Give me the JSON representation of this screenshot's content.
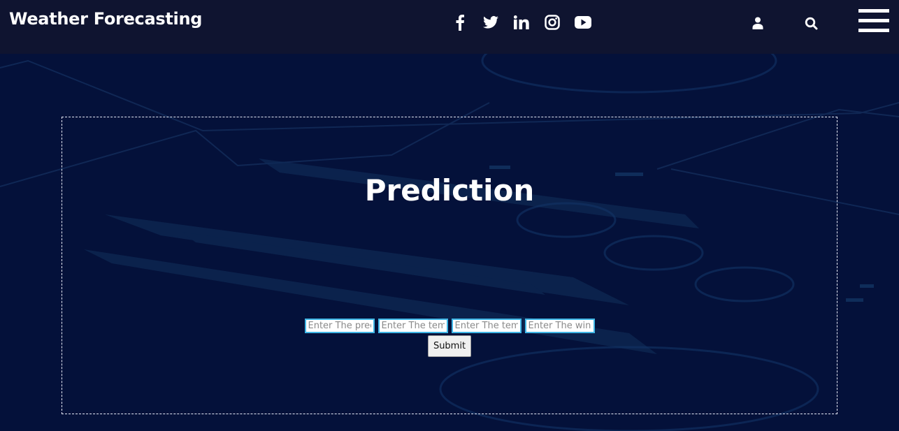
{
  "header": {
    "brand": "Weather Forecasting",
    "social": [
      {
        "name": "facebook-icon"
      },
      {
        "name": "twitter-icon"
      },
      {
        "name": "linkedin-icon"
      },
      {
        "name": "instagram-icon"
      },
      {
        "name": "youtube-icon"
      }
    ],
    "user_icon": "user-icon",
    "search_icon": "search-icon",
    "menu_icon": "hamburger-menu-icon"
  },
  "main": {
    "title": "Prediction",
    "inputs": [
      {
        "placeholder": "Enter The precipitation",
        "value": ""
      },
      {
        "placeholder": "Enter The temp_max",
        "value": ""
      },
      {
        "placeholder": "Enter The temp_min",
        "value": ""
      },
      {
        "placeholder": "Enter The wind",
        "value": ""
      }
    ],
    "submit_label": "Submit"
  },
  "colors": {
    "header_bg": "#0f1430",
    "page_bg": "#04113a",
    "input_border": "#3fb6e6",
    "text": "#ffffff"
  }
}
